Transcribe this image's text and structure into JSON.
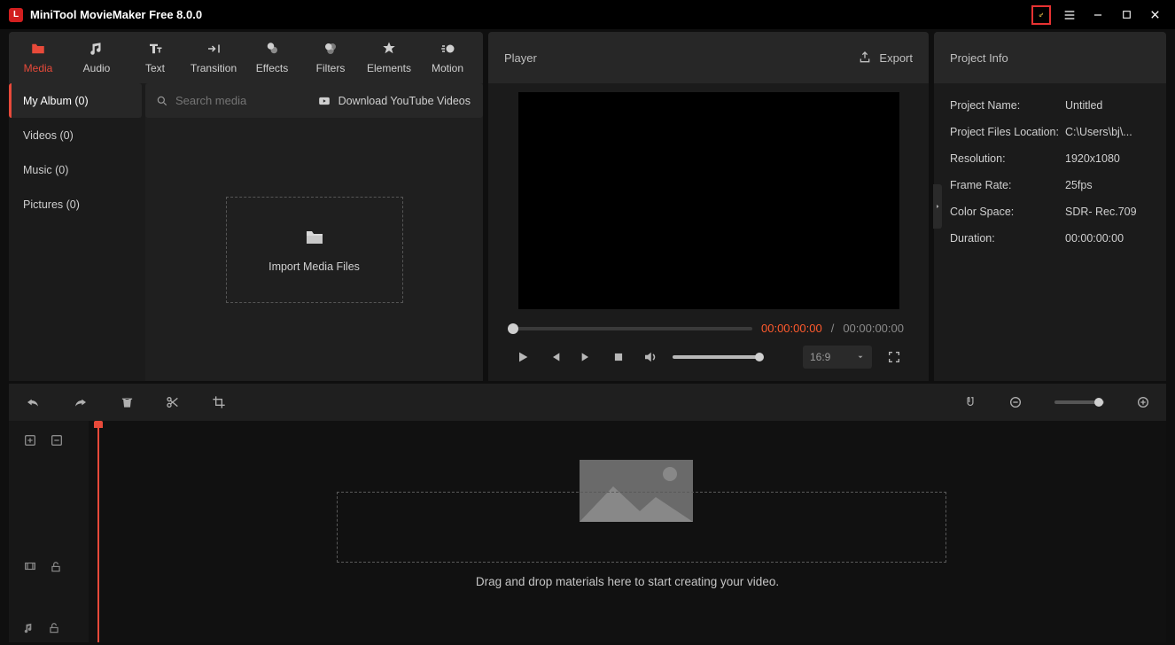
{
  "title": "MiniTool MovieMaker Free 8.0.0",
  "tabs": {
    "media": "Media",
    "audio": "Audio",
    "text": "Text",
    "transition": "Transition",
    "effects": "Effects",
    "filters": "Filters",
    "elements": "Elements",
    "motion": "Motion"
  },
  "sidebar": {
    "items": [
      {
        "label": "My Album (0)"
      },
      {
        "label": "Videos (0)"
      },
      {
        "label": "Music (0)"
      },
      {
        "label": "Pictures (0)"
      }
    ]
  },
  "search": {
    "placeholder": "Search media"
  },
  "yt": {
    "label": "Download YouTube Videos"
  },
  "import": {
    "label": "Import Media Files"
  },
  "player": {
    "title": "Player",
    "export": "Export",
    "curTime": "00:00:00:00",
    "sep": " / ",
    "totTime": "00:00:00:00",
    "aspect": "16:9"
  },
  "project": {
    "title": "Project Info",
    "rows": [
      {
        "k": "Project Name:",
        "v": "Untitled"
      },
      {
        "k": "Project Files Location:",
        "v": "C:\\Users\\bj\\..."
      },
      {
        "k": "Resolution:",
        "v": "1920x1080"
      },
      {
        "k": "Frame Rate:",
        "v": "25fps"
      },
      {
        "k": "Color Space:",
        "v": "SDR- Rec.709"
      },
      {
        "k": "Duration:",
        "v": "00:00:00:00"
      }
    ]
  },
  "timeline": {
    "hint": "Drag and drop materials here to start creating your video."
  }
}
